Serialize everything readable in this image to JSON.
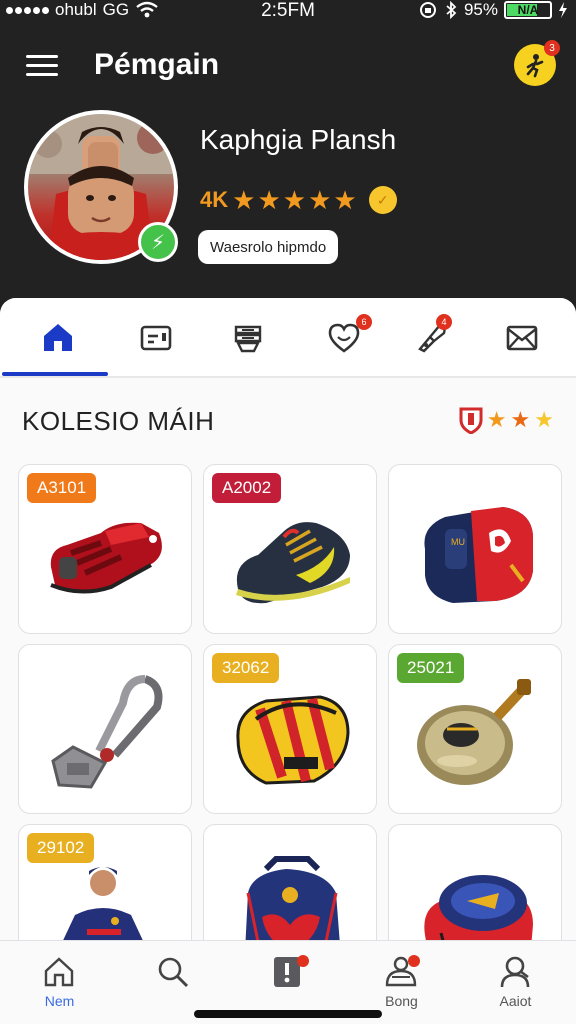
{
  "status_bar": {
    "carrier": "ohubl",
    "network": "GG",
    "time": "2:5FM",
    "battery_percent": "95%",
    "battery_label": "N/A"
  },
  "app_bar": {
    "title": "Pémgain",
    "corner_badge": "3"
  },
  "profile": {
    "name": "Kaphgia Plansh",
    "rating_code": "4K",
    "rating_stars": 5,
    "pill_label": "Waesrolo hipmdo"
  },
  "tabs": [
    {
      "icon": "home-icon",
      "active": true
    },
    {
      "icon": "card-icon",
      "active": false
    },
    {
      "icon": "stack-icon",
      "active": false
    },
    {
      "icon": "chat-heart-icon",
      "badge": "6",
      "active": false
    },
    {
      "icon": "tool-icon",
      "badge": "4",
      "active": false
    },
    {
      "icon": "mail-icon",
      "active": false
    }
  ],
  "section": {
    "title": "KOLESIO MÁIH",
    "stars_filled": 2,
    "stars_total": 3
  },
  "items": [
    {
      "tag": "A3101",
      "tag_color": "#f07a1a",
      "item": "red-cleat-shoe-icon"
    },
    {
      "tag": "A2002",
      "tag_color": "#c21e3a",
      "item": "navy-sneaker-icon"
    },
    {
      "tag": "",
      "tag_color": "",
      "item": "shin-guard-icon"
    },
    {
      "tag": "",
      "tag_color": "",
      "item": "lock-chain-icon"
    },
    {
      "tag": "32062",
      "tag_color": "#e8b020",
      "item": "striped-guard-icon"
    },
    {
      "tag": "25021",
      "tag_color": "#5aa832",
      "item": "brass-horn-icon"
    },
    {
      "tag": "29102",
      "tag_color": "#e8b020",
      "item": "player-figure-icon"
    },
    {
      "tag": "",
      "tag_color": "",
      "item": "backpack-icon"
    },
    {
      "tag": "",
      "tag_color": "",
      "item": "pouch-icon"
    }
  ],
  "bottom_nav": [
    {
      "label": "Nem",
      "icon": "home-icon",
      "active": true
    },
    {
      "label": "",
      "icon": "search-icon",
      "active": false
    },
    {
      "label": "",
      "icon": "alert-icon",
      "active": false
    },
    {
      "label": "Bong",
      "icon": "bong-icon",
      "active": false
    },
    {
      "label": "Aaiot",
      "icon": "profile-icon",
      "active": false
    }
  ],
  "colors": {
    "header_bg": "#222222",
    "accent": "#1b3bc6",
    "star": "#f29a1f",
    "online": "#45c24a"
  }
}
